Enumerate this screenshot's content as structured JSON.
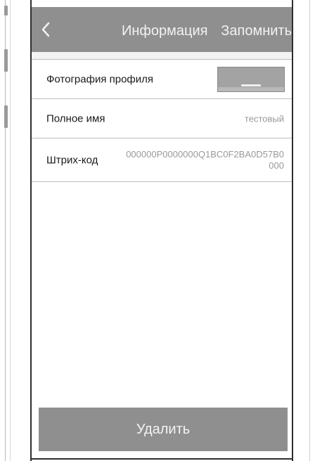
{
  "navbar": {
    "back_icon": "chevron-left-icon",
    "title": "Информация",
    "save_label": "Запомнить"
  },
  "profile": {
    "photo_label": "Фотография профиля",
    "full_name_label": "Полное имя",
    "full_name_value": "тестовый",
    "barcode_label": "Штрих-код",
    "barcode_value": "000000P0000000Q1BC0F2BA0D57B0000"
  },
  "actions": {
    "delete_label": "Удалить"
  },
  "colors": {
    "navbar_bg": "#8f8f8f",
    "button_bg": "#8f8f8f",
    "value_text": "#9a9a9a"
  }
}
